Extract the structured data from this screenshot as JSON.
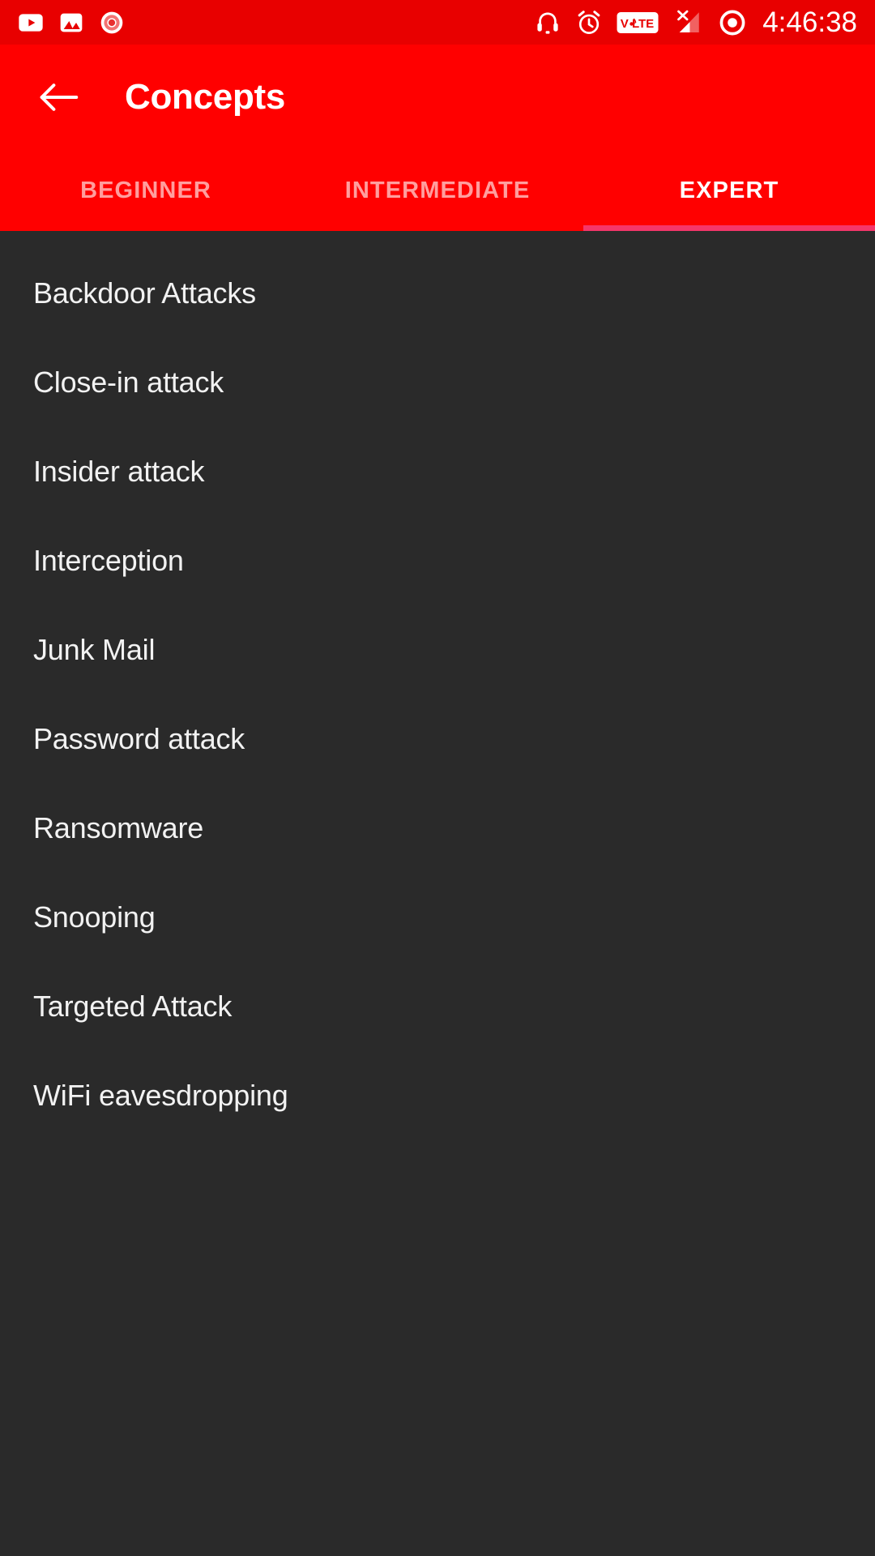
{
  "status_bar": {
    "background_color": "#e80000",
    "time": "4:46:38",
    "left_icons": [
      {
        "name": "youtube-icon",
        "label": "YouTube"
      },
      {
        "name": "gallery-icon",
        "label": "Gallery"
      },
      {
        "name": "screen-record-icon",
        "label": "Screen Recorder"
      }
    ],
    "right_icons": [
      {
        "name": "headphones-icon",
        "label": "Headphones"
      },
      {
        "name": "alarm-icon",
        "label": "Alarm"
      },
      {
        "name": "volte-icon",
        "label": "VoLTE"
      },
      {
        "name": "signal-off-icon",
        "label": "No Signal"
      },
      {
        "name": "record-indicator-icon",
        "label": "Recording"
      }
    ]
  },
  "appbar": {
    "background_color": "#ff0000",
    "back_label": "Back",
    "title": "Concepts"
  },
  "tabs": {
    "active_index": 2,
    "indicator_color": "#f5366a",
    "items": [
      {
        "label": "BEGINNER"
      },
      {
        "label": "INTERMEDIATE"
      },
      {
        "label": "EXPERT"
      }
    ]
  },
  "list": {
    "background_color": "#2a2a2a",
    "items": [
      {
        "label": "Backdoor Attacks"
      },
      {
        "label": "Close-in attack"
      },
      {
        "label": "Insider attack"
      },
      {
        "label": "Interception"
      },
      {
        "label": "Junk Mail"
      },
      {
        "label": "Password attack"
      },
      {
        "label": "Ransomware"
      },
      {
        "label": "Snooping"
      },
      {
        "label": "Targeted Attack"
      },
      {
        "label": "WiFi eavesdropping"
      }
    ]
  }
}
